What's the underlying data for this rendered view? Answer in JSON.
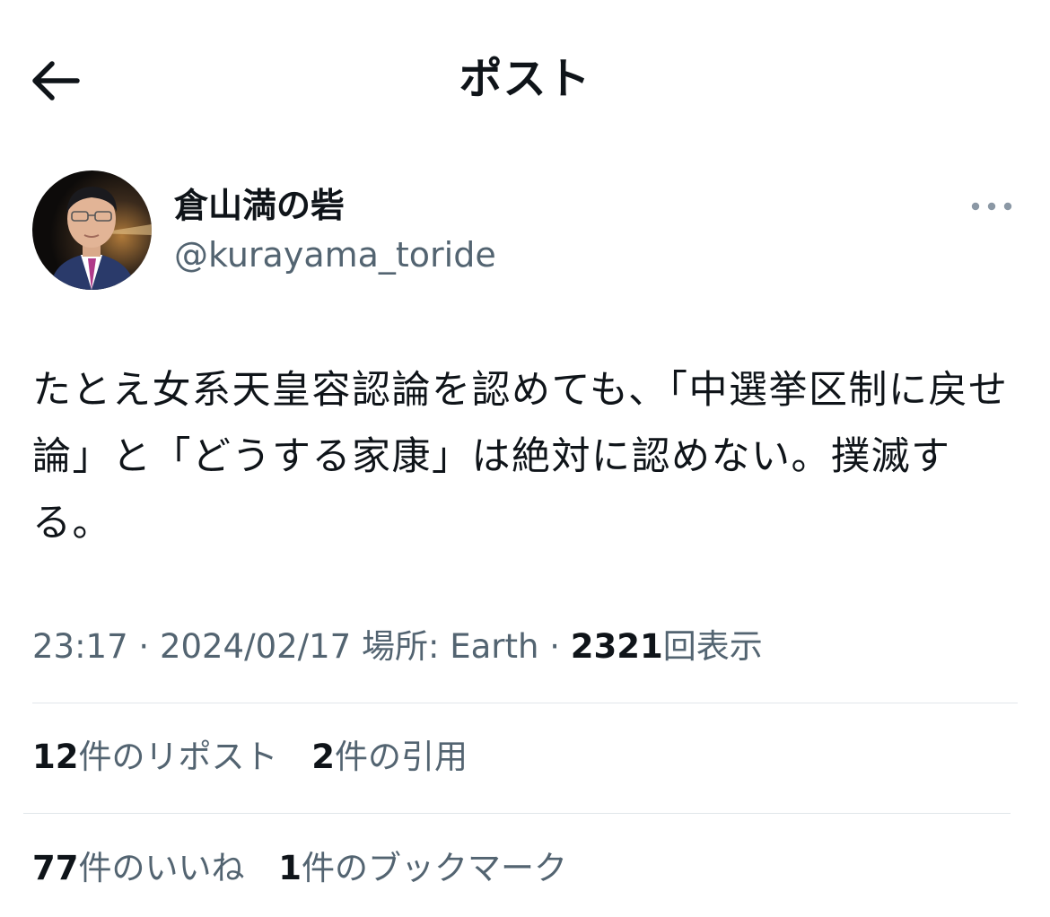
{
  "header": {
    "title": "ポスト",
    "back_icon": "arrow-left-icon"
  },
  "author": {
    "display_name": "倉山満の砦",
    "handle": "@kurayama_toride",
    "more_icon": "ellipsis-icon"
  },
  "tweet": {
    "text": "たとえ女系天皇容認論を認めても、「中選挙区制に戻せ論」と「どうする家康」は絶対に認めない。撲滅する。"
  },
  "meta": {
    "time": "23:17",
    "sep1": "·",
    "date": "2024/02/17",
    "location": "場所: Earth",
    "sep2": "·",
    "views_count": "2321",
    "views_label": "回表示"
  },
  "stats": {
    "reposts_count": "12",
    "reposts_label": "件のリポスト",
    "quotes_count": "2",
    "quotes_label": "件の引用",
    "likes_count": "77",
    "likes_label": "件のいいね",
    "bookmarks_count": "1",
    "bookmarks_label": "件のブックマーク"
  },
  "colors": {
    "text_primary": "#0f1419",
    "text_secondary": "#536471",
    "divider": "#e1e6ea",
    "background": "#ffffff"
  }
}
